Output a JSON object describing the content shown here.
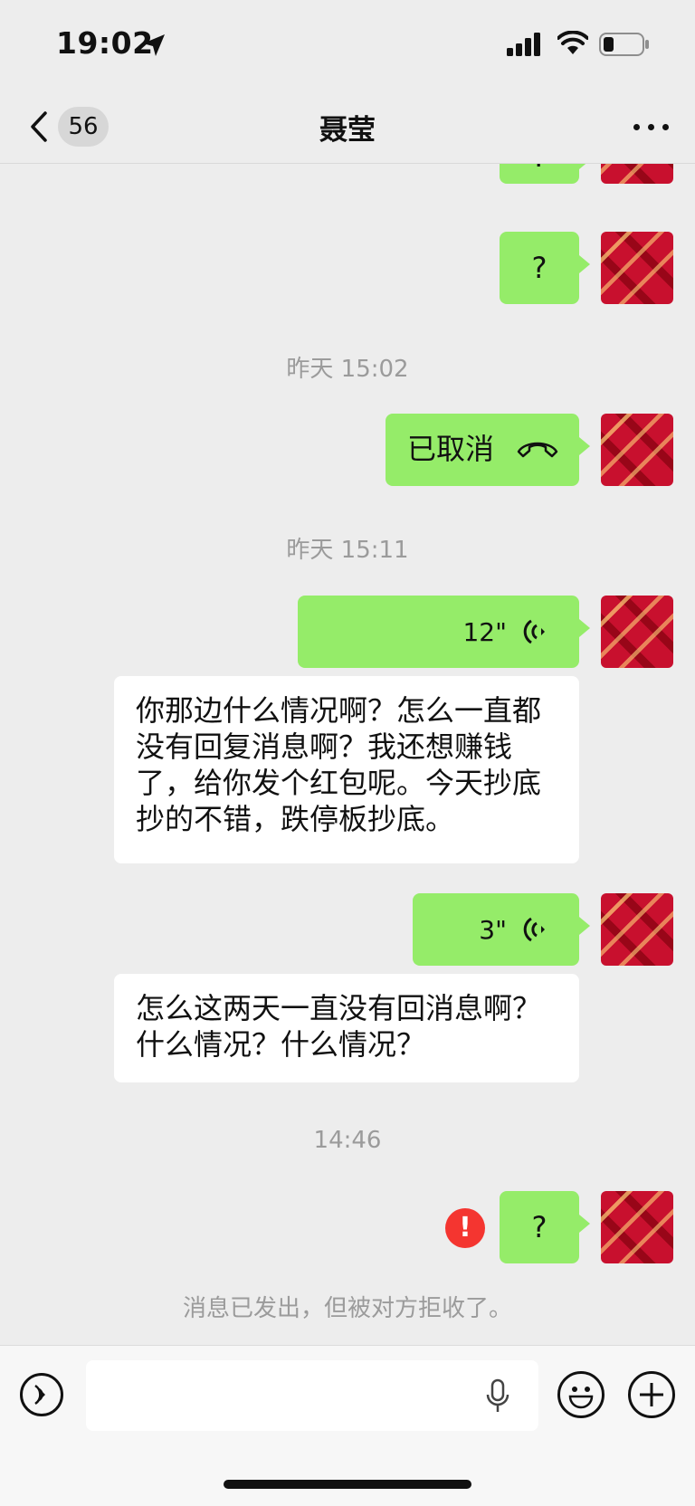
{
  "status_bar": {
    "time": "19:02"
  },
  "nav": {
    "back_count": "56",
    "title": "聂莹"
  },
  "messages": {
    "m1_text": "?",
    "m2_text": "?",
    "ts1": "昨天 15:02",
    "call_text": "已取消",
    "ts2": "昨天 15:11",
    "voice1_duration": "12\"",
    "reply1_line1": "你那边什么情况啊？怎么一直都",
    "reply1_line2": "没有回复消息啊？我还想赚钱",
    "reply1_line3": "了，给你发个红包呢。今天抄底",
    "reply1_line4": "抄的不错，跌停板抄底。",
    "voice2_duration": "3\"",
    "reply2_line1": "怎么这两天一直没有回消息啊？",
    "reply2_line2": "什么情况？什么情况？",
    "ts3": "14:46",
    "m_last_text": "?",
    "error_mark": "!",
    "rejected_notice": "消息已发出，但被对方拒收了。"
  },
  "input": {
    "placeholder": ""
  },
  "colors": {
    "my_bubble": "#95ec69",
    "other_bubble": "#ffffff",
    "error": "#f43530",
    "background": "#ededed"
  },
  "icons": [
    "location-arrow-icon",
    "signal-icon",
    "wifi-icon",
    "battery-icon",
    "back-chevron-icon",
    "more-icon",
    "hangup-icon",
    "voice-wave-icon",
    "error-icon",
    "voice-mode-icon",
    "mic-icon",
    "emoji-icon",
    "plus-icon"
  ]
}
